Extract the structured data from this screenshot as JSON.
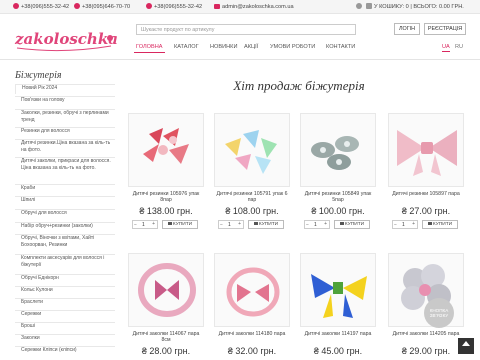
{
  "topbar": {
    "phone1": "+38(096)555-32-42",
    "phone2": "+38(095)646-70-70",
    "phone3": "+38(096)555-32-42",
    "email": "admin@zakoloschka.com.ua",
    "cart_summary": "У КОШИКУ: 0 | ВСЬОГО: 0.00 ГРН."
  },
  "header": {
    "logo_text": "zakoloschka",
    "search_placeholder": "Шукаєте продукт по артикулу",
    "login_label": "ЛОГІН",
    "register_label": "РЕЄСТРАЦІЯ"
  },
  "nav": {
    "items": [
      "ГОЛОВНА",
      "КАТАЛОГ",
      "НОВИНКИ",
      "АКЦІЇ",
      "УМОВИ РОБОТИ",
      "КОНТАКТИ"
    ],
    "lang_ua": "UA",
    "lang_ru": "RU"
  },
  "sidebar": {
    "title": "Біжутерія",
    "items": [
      "Новий Рік 2024",
      "Пов'язки на голову",
      "Заколки, резинки, обручі з перлинами тренд",
      "Резинки для волосся",
      "Дитячі резинки.Ціна вказана за кіль-ть на фото.",
      "Дитячі заколки, прикраси для волосся. Ціна вказана за кіль-ть на фото.",
      "Краби",
      "Шпилі",
      "Обручі для волосся",
      "Набір обруч+резинки (заколки)",
      "Обручі, Віночки з квітами, Хайтi Бохоорван, Резинки",
      "Комплекти аксесуарів для волосся і біжутерії",
      "Обручі Еднікорн",
      "Кольє Кулони",
      "Браслети",
      "Сережки",
      "Броші",
      "Заколки",
      "Сережки Кліпси (кліпси)"
    ]
  },
  "main": {
    "title": "Хіт продаж біжутерія",
    "qty_default": "1",
    "buy_label": "КУПИТИ",
    "products": [
      {
        "name": "Дитячі резинки 105976 упак 8пар",
        "price": "₴ 138.00 грн."
      },
      {
        "name": "Дитячі резинки 105791 упак 6 пар",
        "price": "₴ 108.00 грн."
      },
      {
        "name": "Дитячі резинки 105849 упак 5пар",
        "price": "₴ 100.00 грн."
      },
      {
        "name": "Дитячі резинки 105897 пара",
        "price": "₴ 27.00 грн."
      },
      {
        "name": "Дитячі заколки 114067 пара 8см",
        "price": "₴ 28.00 грн."
      },
      {
        "name": "Дитячі заколки 114180 пара",
        "price": "₴ 32.00 грн."
      },
      {
        "name": "Дитячі заколки 114197 пара",
        "price": "₴ 45.00 грн."
      },
      {
        "name": "Дитячі заколки 114205 пара",
        "price": "₴ 29.00 грн."
      }
    ]
  },
  "callback_label": "КНОПКА ЗВ'ЯЗКУ",
  "colors": {
    "accent": "#d9275f"
  }
}
